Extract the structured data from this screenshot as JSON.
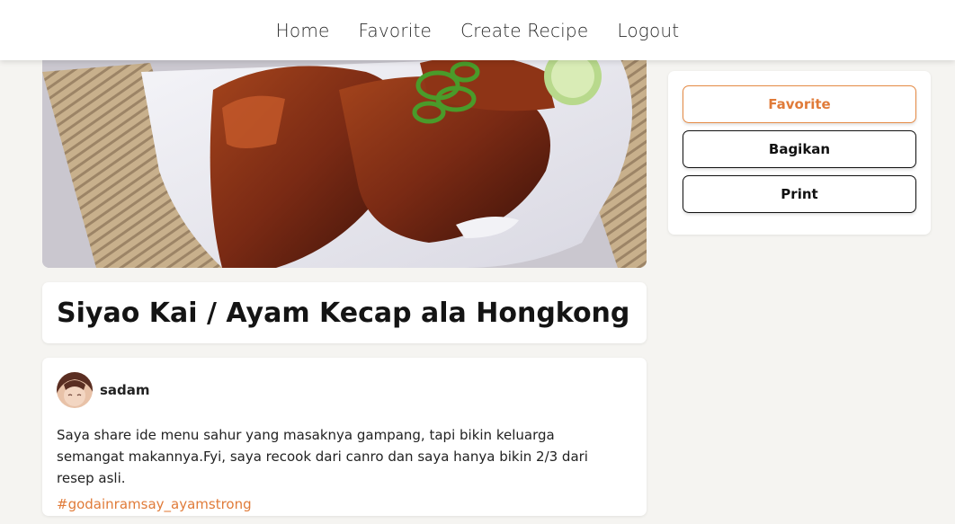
{
  "nav": {
    "items": [
      {
        "label": "Home"
      },
      {
        "label": "Favorite"
      },
      {
        "label": "Create Recipe"
      },
      {
        "label": "Logout"
      }
    ]
  },
  "recipe": {
    "title": "Siyao Kai / Ayam Kecap ala Hongkong",
    "author": "sadam",
    "description": "Saya share ide menu sahur yang masaknya gampang, tapi bikin keluarga semangat makannya.Fyi, saya recook dari canro dan saya hanya bikin 2/3 dari resep asli.",
    "hashtag": "#godainramsay_ayamstrong"
  },
  "actions": {
    "favorite_label": "Favorite",
    "share_label": "Bagikan",
    "print_label": "Print"
  },
  "colors": {
    "accent": "#e07b39",
    "background": "#f5f4f1"
  }
}
